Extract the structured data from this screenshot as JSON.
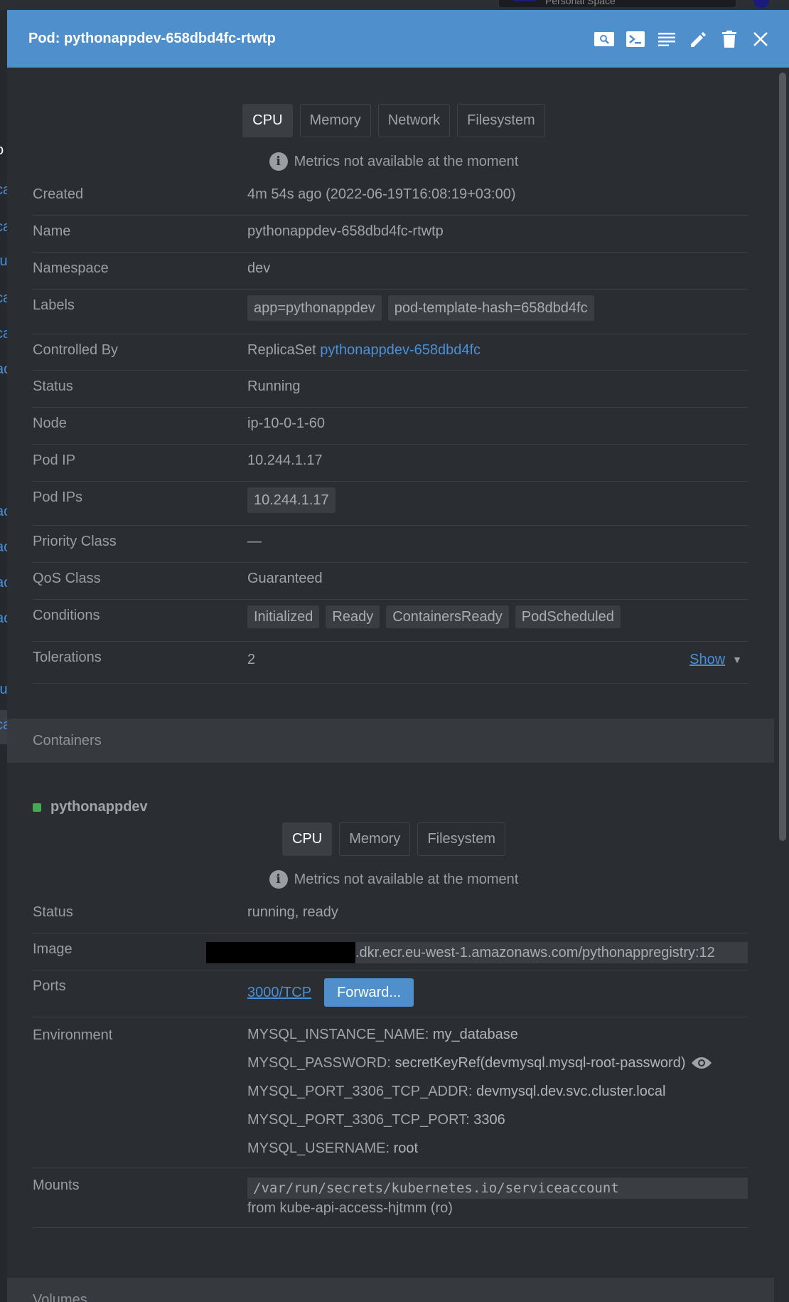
{
  "background": {
    "space_label": "Personal Space",
    "left_fragments": [
      "o",
      "ca",
      "ca",
      "fu",
      "ca",
      "ca",
      "ac",
      "ac",
      "ac",
      "ac",
      "ac",
      "fu",
      "ca"
    ]
  },
  "header": {
    "title": "Pod: pythonappdev-658dbd4fc-rtwtp",
    "actions": [
      "search-icon",
      "terminal-icon",
      "logs-icon",
      "edit-icon",
      "delete-icon",
      "close-icon"
    ]
  },
  "metrics": {
    "tabs": [
      "CPU",
      "Memory",
      "Network",
      "Filesystem"
    ],
    "active_tab": "CPU",
    "notice": "Metrics not available at the moment"
  },
  "details": {
    "created_label": "Created",
    "created_value": "4m 54s ago (2022-06-19T16:08:19+03:00)",
    "name_label": "Name",
    "name_value": "pythonappdev-658dbd4fc-rtwtp",
    "namespace_label": "Namespace",
    "namespace_value": "dev",
    "labels_label": "Labels",
    "labels": [
      "app=pythonappdev",
      "pod-template-hash=658dbd4fc"
    ],
    "controlled_label": "Controlled By",
    "controlled_kind": "ReplicaSet",
    "controlled_link": "pythonappdev-658dbd4fc",
    "status_label": "Status",
    "status_value": "Running",
    "node_label": "Node",
    "node_value": "ip-10-0-1-60",
    "podip_label": "Pod IP",
    "podip_value": "10.244.1.17",
    "podips_label": "Pod IPs",
    "podips_value": "10.244.1.17",
    "priority_label": "Priority Class",
    "priority_value": "—",
    "qos_label": "QoS Class",
    "qos_value": "Guaranteed",
    "conditions_label": "Conditions",
    "conditions": [
      "Initialized",
      "Ready",
      "ContainersReady",
      "PodScheduled"
    ],
    "tolerations_label": "Tolerations",
    "tolerations_value": "2",
    "tolerations_show": "Show"
  },
  "containers": {
    "section_title": "Containers",
    "name": "pythonappdev",
    "tabs": [
      "CPU",
      "Memory",
      "Filesystem"
    ],
    "active_tab": "CPU",
    "notice": "Metrics not available at the moment",
    "status_label": "Status",
    "status_value": "running, ready",
    "image_label": "Image",
    "image_value": ".dkr.ecr.eu-west-1.amazonaws.com/pythonappregistry:12",
    "ports_label": "Ports",
    "port_value": "3000/TCP",
    "forward_label": "Forward...",
    "env_label": "Environment",
    "env": [
      {
        "key": "MYSQL_INSTANCE_NAME:",
        "value": "my_database"
      },
      {
        "key": "MYSQL_PASSWORD:",
        "value": "secretKeyRef(devmysql.mysql-root-password)"
      },
      {
        "key": "MYSQL_PORT_3306_TCP_ADDR:",
        "value": "devmysql.dev.svc.cluster.local"
      },
      {
        "key": "MYSQL_PORT_3306_TCP_PORT:",
        "value": "3306"
      },
      {
        "key": "MYSQL_USERNAME:",
        "value": "root"
      }
    ],
    "mounts_label": "Mounts",
    "mount_path": "/var/run/secrets/kubernetes.io/serviceaccount",
    "mount_from": "from kube-api-access-hjtmm (ro)"
  },
  "volumes": {
    "section_title": "Volumes"
  }
}
